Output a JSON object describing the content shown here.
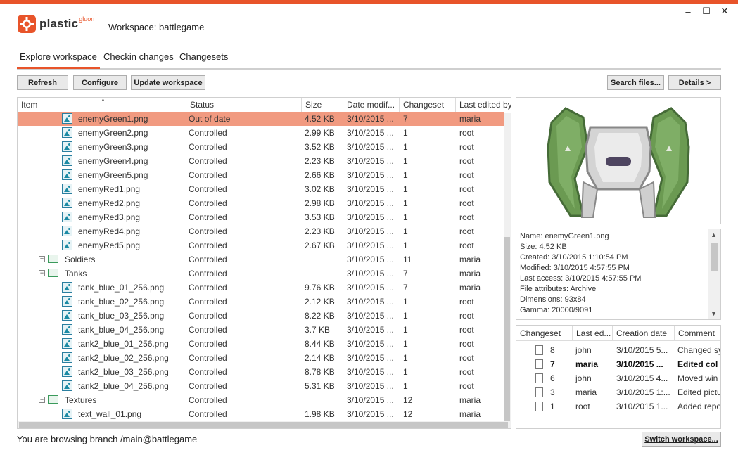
{
  "window": {
    "logo_text": "plastic",
    "logo_sup": "gluon",
    "workspace_title": "Workspace: battlegame",
    "controls": [
      "–",
      "☐",
      "✕"
    ]
  },
  "tabs": [
    {
      "label": "Explore workspace",
      "active": true
    },
    {
      "label": "Checkin changes",
      "active": false
    },
    {
      "label": "Changesets",
      "active": false
    }
  ],
  "toolbar": {
    "refresh": "Refresh",
    "configure": "Configure",
    "update": "Update workspace",
    "search": "Search files...",
    "details": "Details >"
  },
  "grid": {
    "columns": [
      "Item",
      "Status",
      "Size",
      "Date modif...",
      "Changeset",
      "Last edited by"
    ],
    "rows": [
      {
        "type": "file",
        "level": 2,
        "name": "enemyGreen1.png",
        "status": "Out of date",
        "size": "4.52 KB",
        "date": "3/10/2015 ...",
        "cs": "7",
        "by": "maria",
        "selected": true
      },
      {
        "type": "file",
        "level": 2,
        "name": "enemyGreen2.png",
        "status": "Controlled",
        "size": "2.99 KB",
        "date": "3/10/2015 ...",
        "cs": "1",
        "by": "root"
      },
      {
        "type": "file",
        "level": 2,
        "name": "enemyGreen3.png",
        "status": "Controlled",
        "size": "3.52 KB",
        "date": "3/10/2015 ...",
        "cs": "1",
        "by": "root"
      },
      {
        "type": "file",
        "level": 2,
        "name": "enemyGreen4.png",
        "status": "Controlled",
        "size": "2.23 KB",
        "date": "3/10/2015 ...",
        "cs": "1",
        "by": "root"
      },
      {
        "type": "file",
        "level": 2,
        "name": "enemyGreen5.png",
        "status": "Controlled",
        "size": "2.66 KB",
        "date": "3/10/2015 ...",
        "cs": "1",
        "by": "root"
      },
      {
        "type": "file",
        "level": 2,
        "name": "enemyRed1.png",
        "status": "Controlled",
        "size": "3.02 KB",
        "date": "3/10/2015 ...",
        "cs": "1",
        "by": "root"
      },
      {
        "type": "file",
        "level": 2,
        "name": "enemyRed2.png",
        "status": "Controlled",
        "size": "2.98 KB",
        "date": "3/10/2015 ...",
        "cs": "1",
        "by": "root"
      },
      {
        "type": "file",
        "level": 2,
        "name": "enemyRed3.png",
        "status": "Controlled",
        "size": "3.53 KB",
        "date": "3/10/2015 ...",
        "cs": "1",
        "by": "root"
      },
      {
        "type": "file",
        "level": 2,
        "name": "enemyRed4.png",
        "status": "Controlled",
        "size": "2.23 KB",
        "date": "3/10/2015 ...",
        "cs": "1",
        "by": "root"
      },
      {
        "type": "file",
        "level": 2,
        "name": "enemyRed5.png",
        "status": "Controlled",
        "size": "2.67 KB",
        "date": "3/10/2015 ...",
        "cs": "1",
        "by": "root"
      },
      {
        "type": "folder",
        "level": 1,
        "expander": "+",
        "name": "Soldiers",
        "status": "Controlled",
        "size": "",
        "date": "3/10/2015 ...",
        "cs": "11",
        "by": "maria"
      },
      {
        "type": "folder",
        "level": 1,
        "expander": "−",
        "name": "Tanks",
        "status": "Controlled",
        "size": "",
        "date": "3/10/2015 ...",
        "cs": "7",
        "by": "maria"
      },
      {
        "type": "file",
        "level": 2,
        "name": "tank_blue_01_256.png",
        "status": "Controlled",
        "size": "9.76 KB",
        "date": "3/10/2015 ...",
        "cs": "7",
        "by": "maria"
      },
      {
        "type": "file",
        "level": 2,
        "name": "tank_blue_02_256.png",
        "status": "Controlled",
        "size": "2.12 KB",
        "date": "3/10/2015 ...",
        "cs": "1",
        "by": "root"
      },
      {
        "type": "file",
        "level": 2,
        "name": "tank_blue_03_256.png",
        "status": "Controlled",
        "size": "8.22 KB",
        "date": "3/10/2015 ...",
        "cs": "1",
        "by": "root"
      },
      {
        "type": "file",
        "level": 2,
        "name": "tank_blue_04_256.png",
        "status": "Controlled",
        "size": "3.7 KB",
        "date": "3/10/2015 ...",
        "cs": "1",
        "by": "root"
      },
      {
        "type": "file",
        "level": 2,
        "name": "tank2_blue_01_256.png",
        "status": "Controlled",
        "size": "8.44 KB",
        "date": "3/10/2015 ...",
        "cs": "1",
        "by": "root"
      },
      {
        "type": "file",
        "level": 2,
        "name": "tank2_blue_02_256.png",
        "status": "Controlled",
        "size": "2.14 KB",
        "date": "3/10/2015 ...",
        "cs": "1",
        "by": "root"
      },
      {
        "type": "file",
        "level": 2,
        "name": "tank2_blue_03_256.png",
        "status": "Controlled",
        "size": "8.78 KB",
        "date": "3/10/2015 ...",
        "cs": "1",
        "by": "root"
      },
      {
        "type": "file",
        "level": 2,
        "name": "tank2_blue_04_256.png",
        "status": "Controlled",
        "size": "5.31 KB",
        "date": "3/10/2015 ...",
        "cs": "1",
        "by": "root"
      },
      {
        "type": "folder",
        "level": 1,
        "expander": "−",
        "name": "Textures",
        "status": "Controlled",
        "size": "",
        "date": "3/10/2015 ...",
        "cs": "12",
        "by": "maria"
      },
      {
        "type": "file",
        "level": 2,
        "name": "text_wall_01.png",
        "status": "Controlled",
        "size": "1.98 KB",
        "date": "3/10/2015 ...",
        "cs": "12",
        "by": "maria"
      }
    ]
  },
  "properties": [
    "Name: enemyGreen1.png",
    "Size: 4.52 KB",
    "Created: 3/10/2015 1:10:54 PM",
    "Modified: 3/10/2015 4:57:55 PM",
    "Last access: 3/10/2015 4:57:55 PM",
    "File attributes: Archive",
    "Dimensions: 93x84",
    "Gamma: 20000/9091"
  ],
  "history": {
    "columns": [
      "Changeset",
      "Last ed...",
      "Creation date",
      "Comment"
    ],
    "rows": [
      {
        "cs": "8",
        "by": "john",
        "date": "3/10/2015 5...",
        "comment": "Changed sy",
        "bold": false
      },
      {
        "cs": "7",
        "by": "maria",
        "date": "3/10/2015 ...",
        "comment": "Edited col",
        "bold": true
      },
      {
        "cs": "6",
        "by": "john",
        "date": "3/10/2015 4...",
        "comment": "Moved win",
        "bold": false
      },
      {
        "cs": "3",
        "by": "maria",
        "date": "3/10/2015 1:...",
        "comment": "Edited pictu",
        "bold": false
      },
      {
        "cs": "1",
        "by": "root",
        "date": "3/10/2015 1...",
        "comment": "Added repo",
        "bold": false
      }
    ]
  },
  "status_bar": {
    "text": "You are browsing branch /main@battlegame",
    "switch_button": "Switch workspace..."
  },
  "colors": {
    "accent": "#e8542a",
    "selection": "#f19a80",
    "sprite_green": "#6b9a52"
  }
}
